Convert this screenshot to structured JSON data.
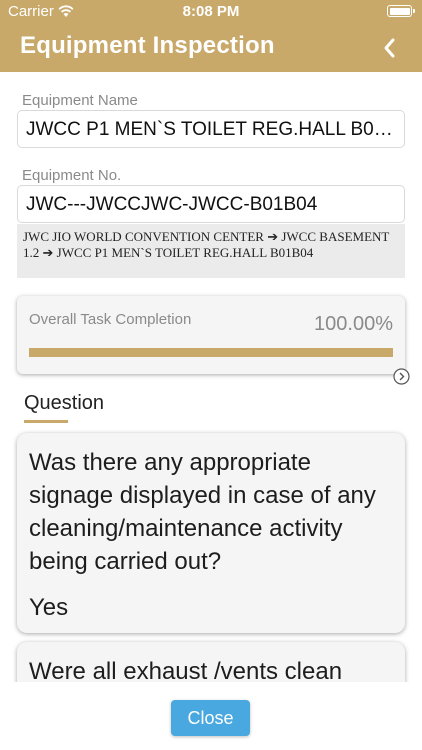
{
  "status_bar": {
    "carrier": "Carrier",
    "time": "8:08 PM"
  },
  "header": {
    "title": "Equipment Inspection"
  },
  "equipment_name": {
    "label": "Equipment Name",
    "value": "JWCC  P1 MEN`S TOILET  REG.HALL B01B04"
  },
  "equipment_no": {
    "label": "Equipment No.",
    "value": "JWC---JWCCJWC-JWCC-B01B04"
  },
  "location_path": "JWC JIO WORLD CONVENTION CENTER ➔ JWCC BASEMENT 1.2 ➔ JWCC P1 MEN`S TOILET REG.HALL B01B04",
  "progress": {
    "label": "Overall Task Completion",
    "value_text": "100.00%",
    "fraction": 1.0
  },
  "question_section": {
    "header": "Question"
  },
  "questions": [
    {
      "text": "Was there any appropriate signage displayed in case of any cleaning/maintenance activity being carried out?",
      "answer": "Yes"
    },
    {
      "text": "Were all exhaust /vents clean"
    }
  ],
  "footer": {
    "close_label": "Close"
  },
  "colors": {
    "accent": "#c8a96a",
    "button": "#4aa8e0"
  },
  "icons": {
    "back": "chevron-left-icon",
    "wifi": "wifi-icon",
    "battery": "battery-icon",
    "expand": "circle-arrow-right-icon"
  }
}
